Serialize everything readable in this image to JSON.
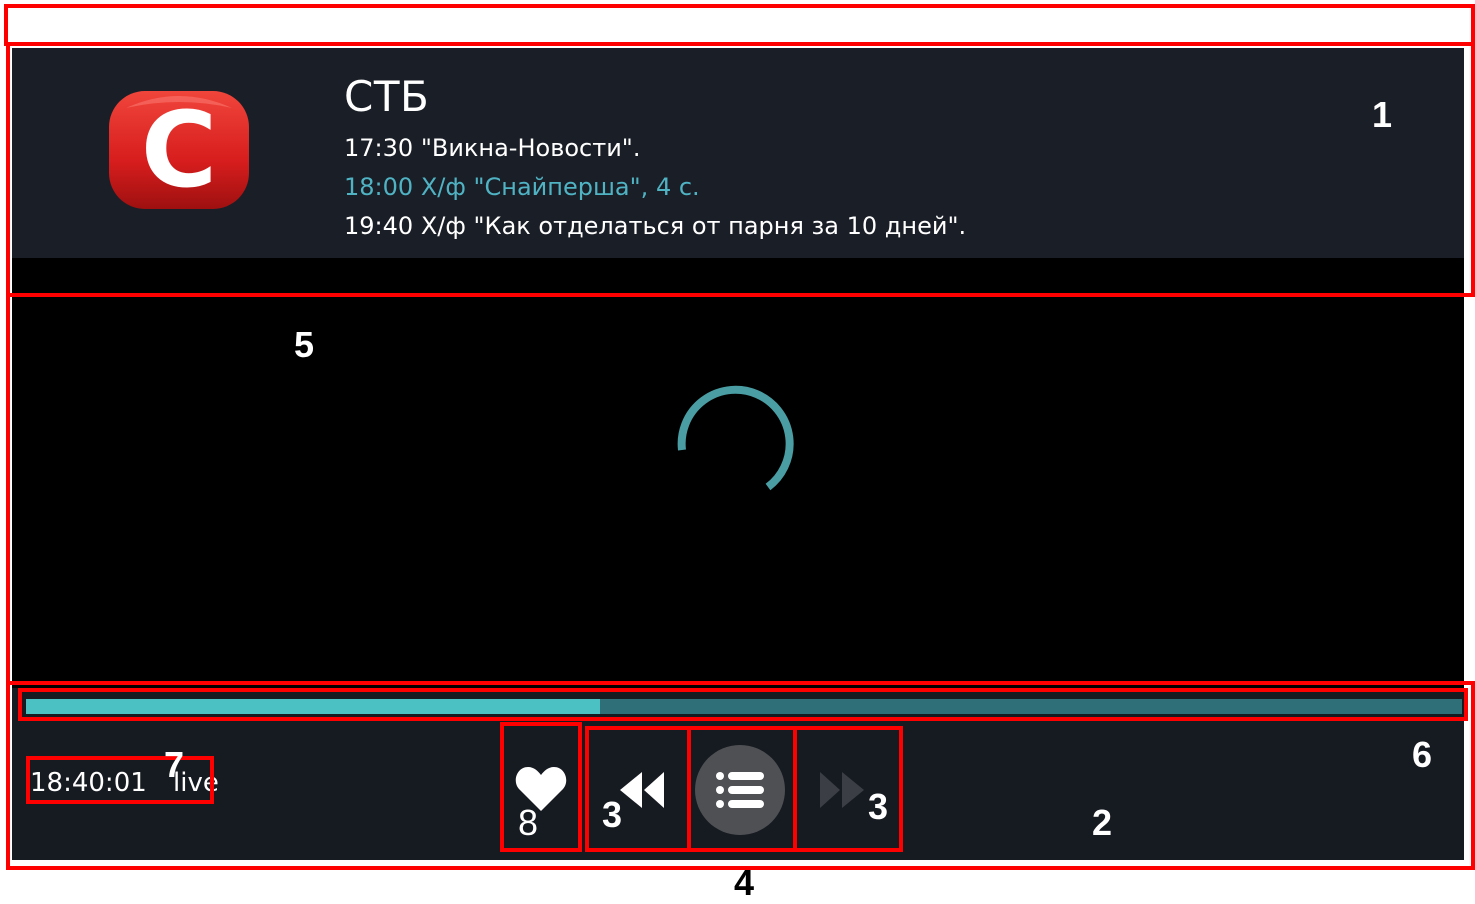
{
  "channel": {
    "name": "СТБ",
    "logo_letter": "C"
  },
  "schedule": [
    {
      "time": "17:30",
      "title": "\"Викна-Новости\".",
      "state": "past"
    },
    {
      "time": "18:00",
      "title": "Х/ф \"Снайперша\", 4 с.",
      "state": "current"
    },
    {
      "time": "19:40",
      "title": "Х/ф \"Как отделаться от парня за 10 дней\".",
      "state": "upcoming"
    }
  ],
  "player": {
    "status": "loading",
    "current_time": "18:40:01",
    "mode_label": "live",
    "progress_fraction": 0.4
  },
  "controls": {
    "favorite_icon": "heart-icon",
    "rewind_icon": "rewind-icon",
    "playlist_icon": "list-icon",
    "forward_icon": "fast-forward-icon"
  },
  "annotations": [
    "1",
    "5",
    "6",
    "7",
    "8",
    "3",
    "3",
    "2",
    "4"
  ],
  "colors": {
    "accent": "#4cc1c3",
    "track": "#2f6f77",
    "header_bg": "#1a1e26",
    "current_program": "#4fb3c4",
    "annotation": "#ff0000"
  }
}
